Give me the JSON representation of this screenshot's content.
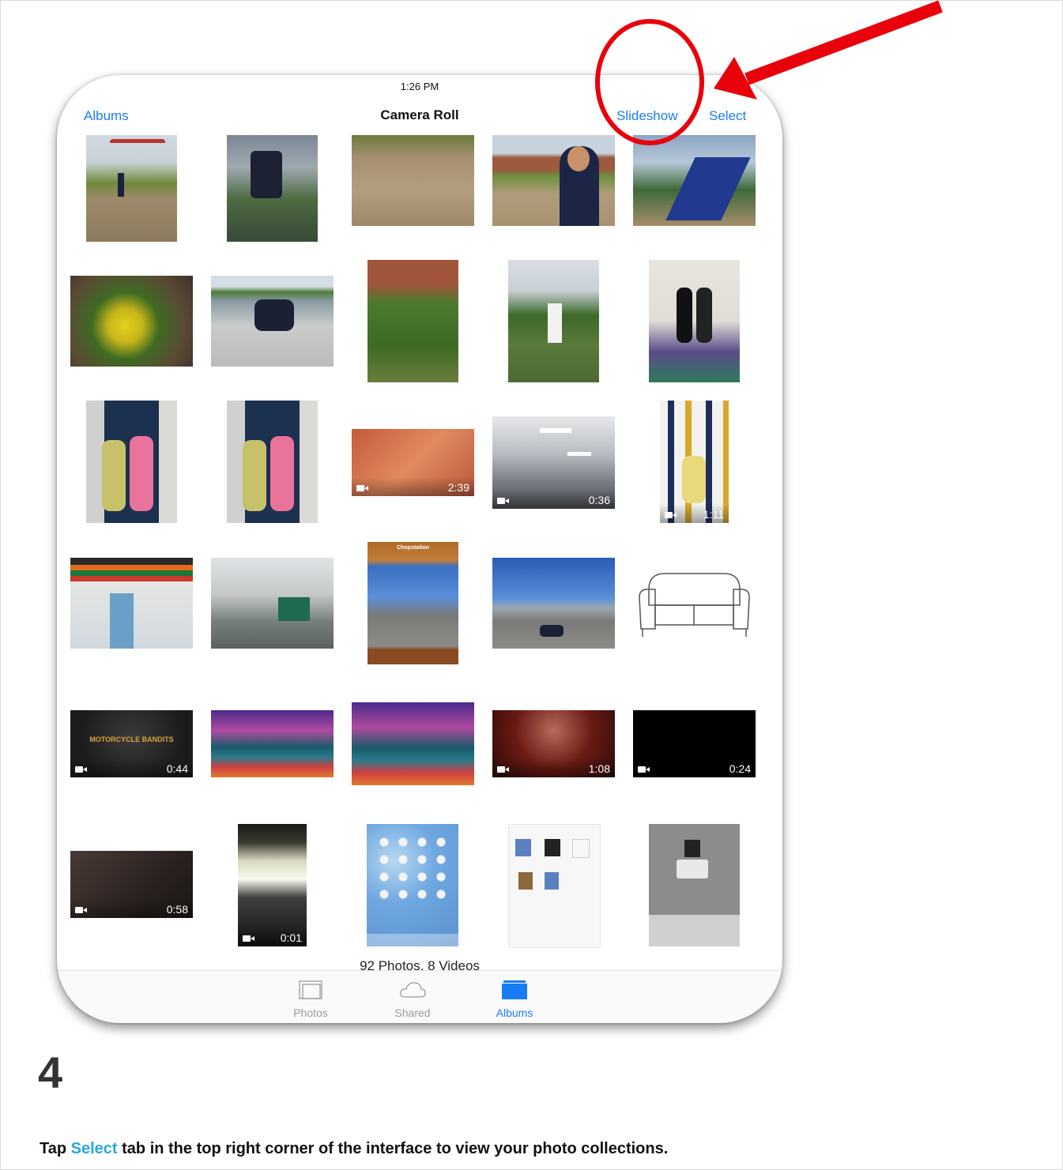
{
  "status_bar": {
    "time": "1:26 PM"
  },
  "nav": {
    "back_label": "Albums",
    "title": "Camera Roll",
    "slideshow_label": "Slideshow",
    "select_label": "Select"
  },
  "videos": [
    {
      "duration": "2:39"
    },
    {
      "duration": "0:36"
    },
    {
      "duration": "1:11"
    },
    {
      "duration": "0:44"
    },
    {
      "duration": "1:08"
    },
    {
      "duration": "0:24"
    },
    {
      "duration": "0:58"
    },
    {
      "duration": "0:01"
    }
  ],
  "thumbnail_text": {
    "motorcycle_title": "MOTORCYCLE BANDITS",
    "app_title": "Chopstation"
  },
  "footer": {
    "count": "92 Photos, 8 Videos"
  },
  "tabs": [
    {
      "label": "Photos",
      "icon": "photos-stack-icon"
    },
    {
      "label": "Shared",
      "icon": "cloud-icon"
    },
    {
      "label": "Albums",
      "icon": "albums-folder-icon"
    }
  ],
  "step": {
    "number": "4"
  },
  "instruction": {
    "prefix": "Tap ",
    "highlight": "Select",
    "suffix": " tab in the top right corner of the interface to view your photo collections."
  },
  "colors": {
    "ios_blue": "#1a7cf5",
    "annotation_red": "#e8000b",
    "highlight": "#2aa7e2"
  }
}
